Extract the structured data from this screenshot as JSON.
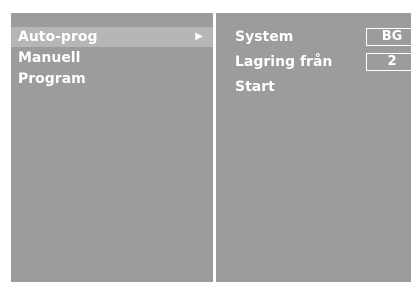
{
  "menu": {
    "items": [
      {
        "label": "Auto-prog",
        "selected": true,
        "submenu_icon": "play-triangle-icon"
      },
      {
        "label": "Manuell"
      },
      {
        "label": "Program"
      }
    ]
  },
  "settings": {
    "system": {
      "label": "System",
      "value": "BG"
    },
    "storage_from": {
      "label": "Lagring från",
      "value": "2"
    },
    "start": {
      "label": "Start"
    }
  },
  "colors": {
    "panel": "#9c9c9c",
    "highlight": "#b6b6b6",
    "text": "#ffffff"
  }
}
